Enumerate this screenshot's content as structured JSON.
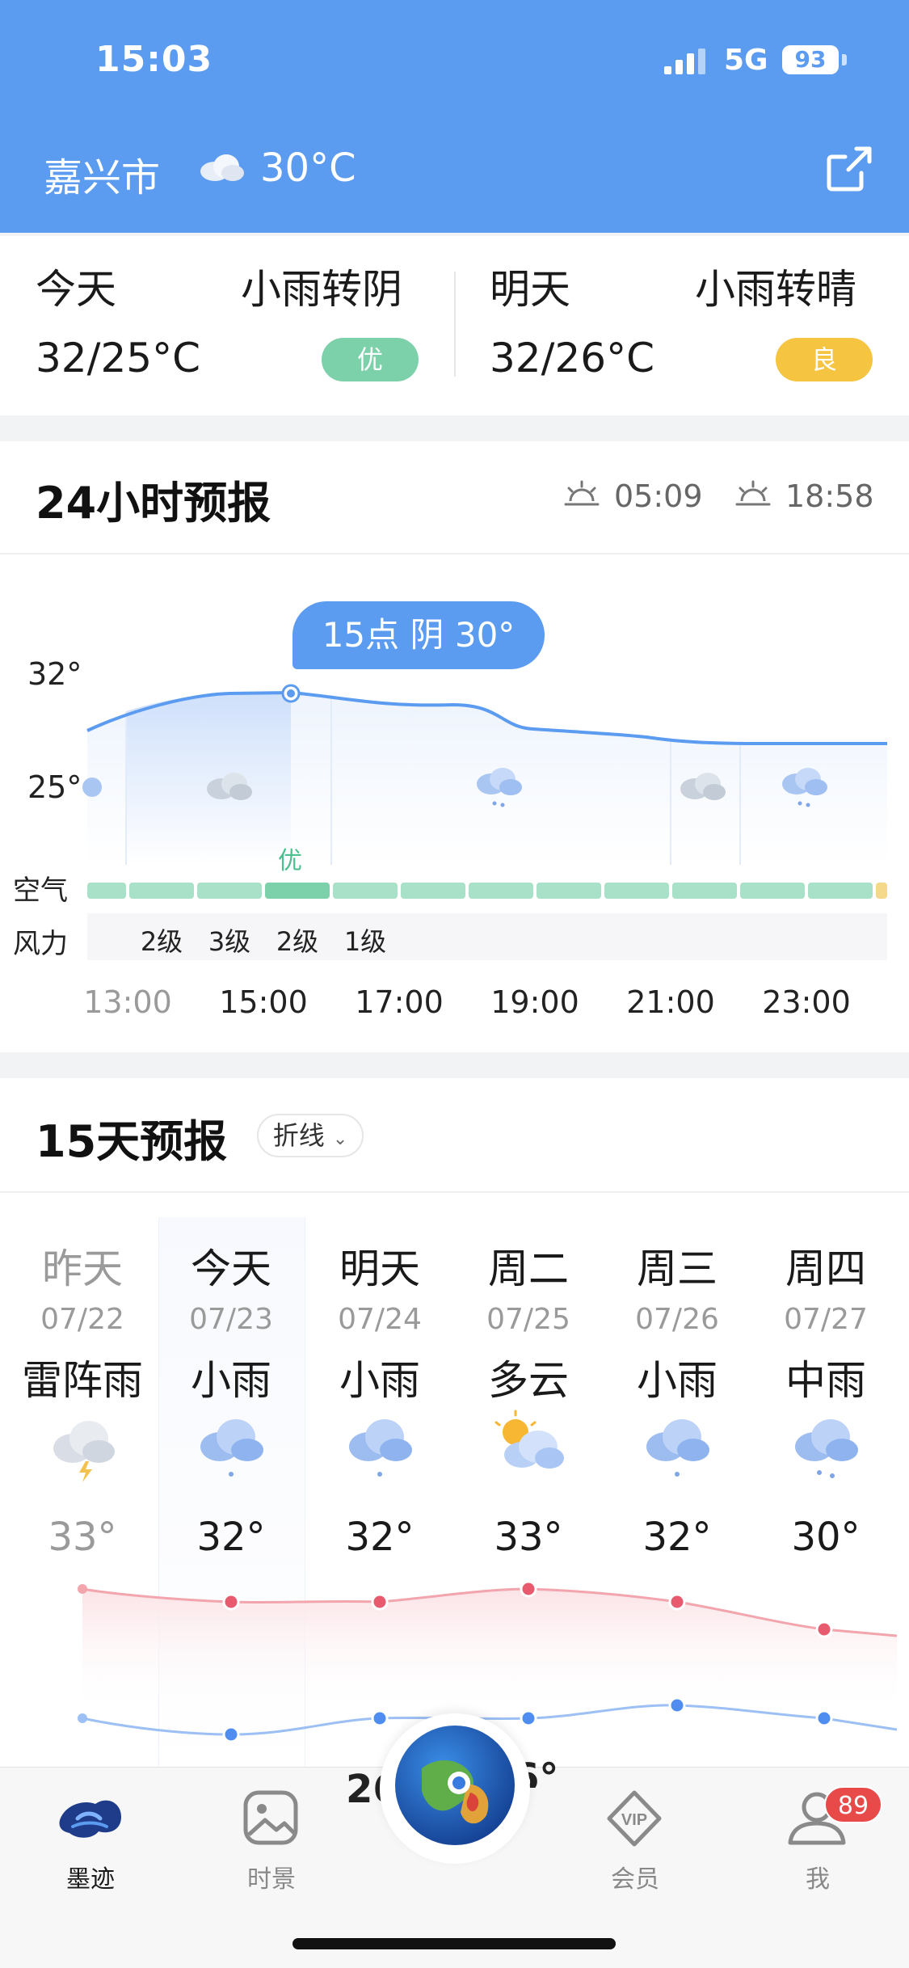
{
  "status_bar": {
    "time": "15:03",
    "network": "5G",
    "battery": "93"
  },
  "header": {
    "city": "嘉兴市",
    "current_temp": "30°C",
    "weather_icon": "cloud-icon",
    "share_icon": "share-icon"
  },
  "summary": {
    "today": {
      "label": "今天",
      "condition": "小雨转阴",
      "temp_range": "32/25°C",
      "aqi": "优",
      "aqi_color": "#7dd1aa"
    },
    "tomorrow": {
      "label": "明天",
      "condition": "小雨转晴",
      "temp_range": "32/26°C",
      "aqi": "良",
      "aqi_color": "#f5c542"
    }
  },
  "hourly": {
    "title": "24小时预报",
    "sunrise": "05:09",
    "sunset": "18:58",
    "tooltip": "15点 阴 30°",
    "y_high": "32°",
    "y_low": "25°",
    "air_label": "空气",
    "wind_label": "风力",
    "air_good_label": "优",
    "wind": [
      "2级",
      "3级",
      "2级",
      "1级"
    ],
    "times": [
      "13:00",
      "15:00",
      "17:00",
      "19:00",
      "21:00",
      "23:00"
    ]
  },
  "daily": {
    "title": "15天预报",
    "mode": "折线",
    "days": [
      {
        "name": "昨天",
        "date": "07/22",
        "cond": "雷阵雨",
        "high": "33°",
        "icon": "thunderstorm-icon"
      },
      {
        "name": "今天",
        "date": "07/23",
        "cond": "小雨",
        "high": "32°",
        "icon": "light-rain-icon"
      },
      {
        "name": "明天",
        "date": "07/24",
        "cond": "小雨",
        "high": "32°",
        "icon": "light-rain-icon"
      },
      {
        "name": "周二",
        "date": "07/25",
        "cond": "多云",
        "high": "33°",
        "icon": "partly-cloudy-icon"
      },
      {
        "name": "周三",
        "date": "07/26",
        "cond": "小雨",
        "high": "32°",
        "icon": "light-rain-icon"
      },
      {
        "name": "周四",
        "date": "07/27",
        "cond": "中雨",
        "high": "30°",
        "icon": "moderate-rain-icon"
      }
    ],
    "low_partial": {
      "day2": "26",
      "day3": "6°"
    }
  },
  "tabbar": {
    "items": [
      {
        "label": "墨迹",
        "icon": "moji-logo-icon"
      },
      {
        "label": "时景",
        "icon": "photo-icon"
      },
      {
        "label": "",
        "icon": "globe-icon"
      },
      {
        "label": "会员",
        "icon": "vip-icon"
      },
      {
        "label": "我",
        "icon": "user-icon"
      }
    ],
    "badge": "89"
  }
}
